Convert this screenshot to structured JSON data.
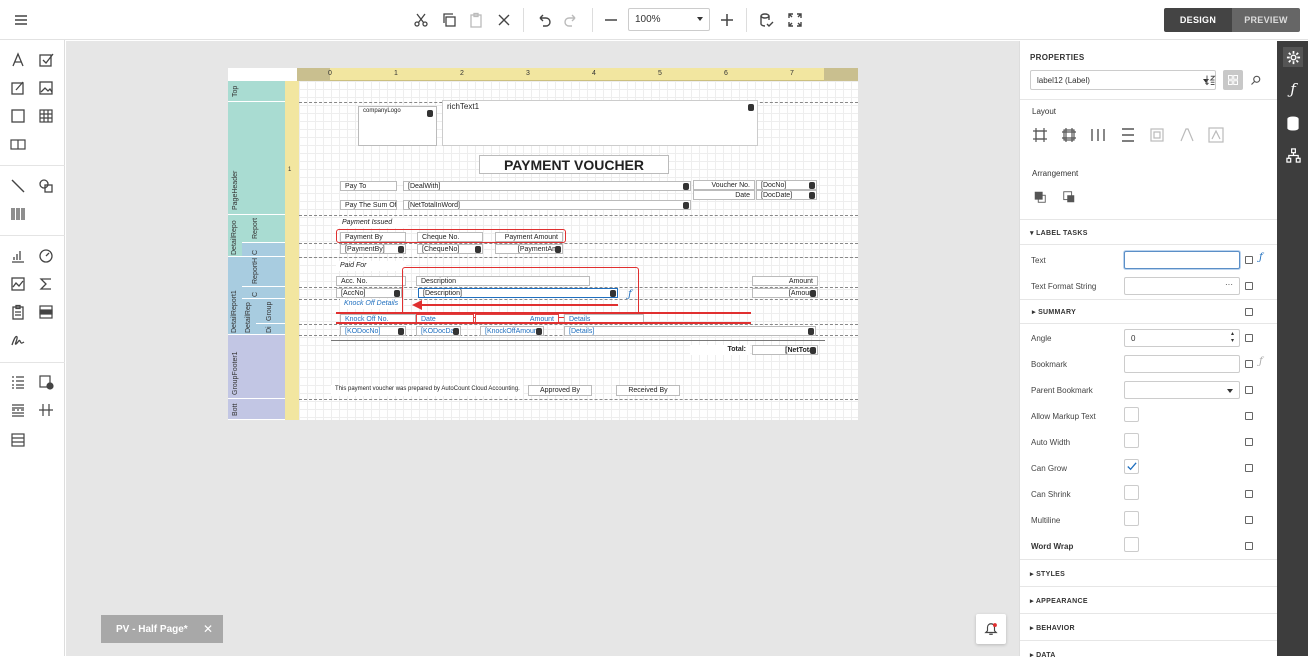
{
  "toolbar": {
    "zoom_value": "100%",
    "design_label": "DESIGN",
    "preview_label": "PREVIEW"
  },
  "document_tab": {
    "label": "PV - Half Page*",
    "close": "✕"
  },
  "report": {
    "bands": {
      "top": "Top",
      "page_header": "PageHeader",
      "detail_report": "DetailRepo",
      "report": "Report",
      "c1": "C",
      "reporth": "ReportH",
      "c2": "C",
      "detail_report1": "DetailReport1",
      "detail_rep": "DetailRep",
      "group": "Group",
      "di": "Di",
      "group_footer": "GroupFooter1",
      "bott": "Bott"
    },
    "ruler_numbers": [
      "0",
      "1",
      "2",
      "3",
      "4",
      "5",
      "6",
      "7"
    ],
    "left_ruler_numbers": [
      "1",
      "1",
      "1",
      "1",
      "1"
    ],
    "company_logo": "companyLogo",
    "rich_text": "richText1",
    "title": "PAYMENT VOUCHER",
    "pay_to": "Pay To",
    "deal_with": "[DealWith]",
    "voucher_no": "Voucher No.",
    "colon": ":",
    "doc_no": "[DocNo]",
    "date": "Date",
    "doc_date": "[DocDate]",
    "pay_sum": "Pay The Sum Of",
    "net_total_word": "[NetTotalInWord]",
    "payment_issued": "Payment Issued",
    "payment_by": "Payment By",
    "cheque_no": "Cheque No.",
    "payment_amount": "Payment Amount",
    "payment_by_field": "[PaymentBy]",
    "cheque_no_field": "[ChequeNo]",
    "payment_amt_field": "[PaymentAm",
    "paid_for": "Paid For",
    "acc_no": "Acc. No.",
    "description": "Description",
    "amount": "Amount",
    "acc_no_field": "[AccNo]",
    "description_field": "[Description]",
    "amount_field": "[Amoun",
    "knock_off_details": "Knock Off Details",
    "knock_off_no": "Knock Off No.",
    "ko_date": "Date",
    "ko_amount": "Amount",
    "ko_details": "Details",
    "ko_doc_no": "[KODocNo]",
    "ko_doc_date": "[KODocDa",
    "ko_amount_field": "[KnockOffAmoun",
    "details_field": "[Details]",
    "total": "Total:",
    "net_total": "[NetTota",
    "prepared_note": "This payment voucher was prepared by AutoCount Cloud Accounting.",
    "approved_by": "Approved By",
    "received_by": "Received By"
  },
  "properties": {
    "title": "PROPERTIES",
    "selected": "label12 (Label)",
    "layout": "Layout",
    "arrangement": "Arrangement",
    "label_tasks": "LABEL TASKS",
    "text": "Text",
    "text_value": "",
    "text_format_string": "Text Format String",
    "ellipsis": "···",
    "summary": "SUMMARY",
    "angle": "Angle",
    "angle_value": "0",
    "bookmark": "Bookmark",
    "parent_bookmark": "Parent Bookmark",
    "allow_markup": "Allow Markup Text",
    "auto_width": "Auto Width",
    "can_grow": "Can Grow",
    "can_shrink": "Can Shrink",
    "multiline": "Multiline",
    "word_wrap": "Word Wrap",
    "styles": "STYLES",
    "appearance": "APPEARANCE",
    "behavior": "BEHAVIOR",
    "data": "DATA"
  },
  "colors": {
    "accent_red": "#e03030",
    "band_teal": "#a9dcd2",
    "band_blue": "#a8cce0",
    "band_purple": "#c2c6e4",
    "ruler_yellow": "#f2e6a0"
  }
}
